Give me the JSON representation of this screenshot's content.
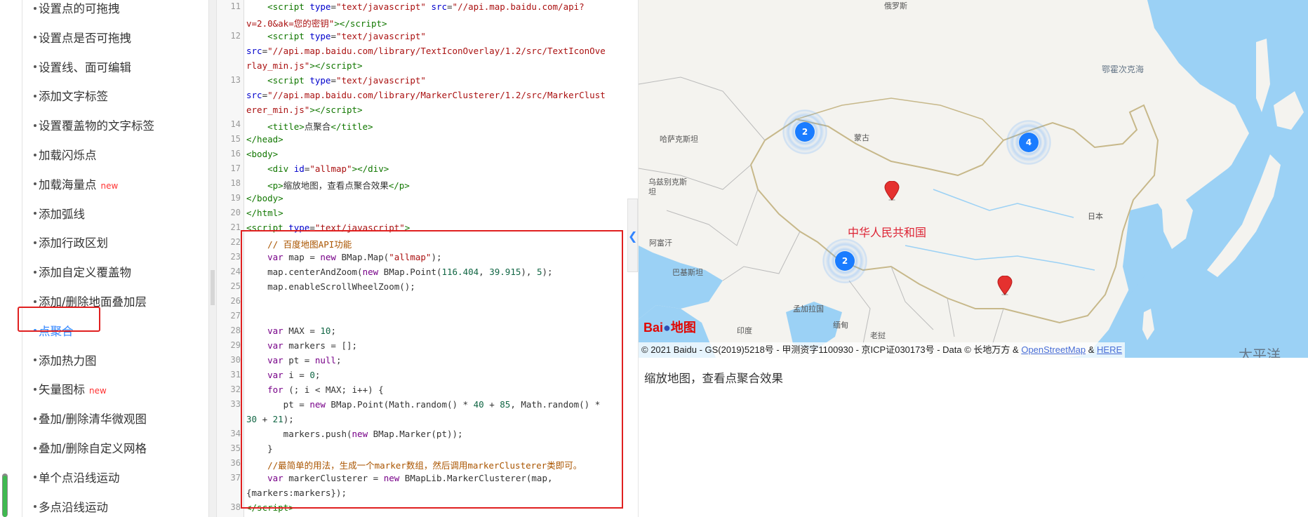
{
  "sidebar": {
    "items": [
      {
        "label": "设置点的可拖拽",
        "badge": ""
      },
      {
        "label": "设置点是否可拖拽",
        "badge": ""
      },
      {
        "label": "设置线、面可编辑",
        "badge": ""
      },
      {
        "label": "添加文字标签",
        "badge": ""
      },
      {
        "label": "设置覆盖物的文字标签",
        "badge": ""
      },
      {
        "label": "加载闪烁点",
        "badge": ""
      },
      {
        "label": "加载海量点",
        "badge": "new"
      },
      {
        "label": "添加弧线",
        "badge": ""
      },
      {
        "label": "添加行政区划",
        "badge": ""
      },
      {
        "label": "添加自定义覆盖物",
        "badge": ""
      },
      {
        "label": "添加/删除地面叠加层",
        "badge": ""
      },
      {
        "label": "点聚合",
        "badge": "",
        "active": true
      },
      {
        "label": "添加热力图",
        "badge": ""
      },
      {
        "label": "矢量图标",
        "badge": "new"
      },
      {
        "label": "叠加/删除清华微观图",
        "badge": ""
      },
      {
        "label": "叠加/删除自定义网格",
        "badge": ""
      },
      {
        "label": "单个点沿线运动",
        "badge": ""
      },
      {
        "label": "多点沿线运动",
        "badge": ""
      }
    ]
  },
  "editor": {
    "line_numbers": [
      "11",
      "12",
      "13",
      "14",
      "15",
      "16",
      "17",
      "18",
      "19",
      "20",
      "21",
      "22",
      "23",
      "24",
      "25",
      "26",
      "27",
      "28",
      "29",
      "30",
      "31",
      "32",
      "33",
      "34",
      "35",
      "36",
      "37",
      "38"
    ]
  },
  "map": {
    "labels": {
      "russia": "俄罗斯",
      "okhotsk": "鄂霍次克海",
      "kazakhstan": "哈萨克斯坦",
      "mongolia": "蒙古",
      "uzbekistan": "乌兹别克斯坦",
      "afghanistan": "阿富汗",
      "pakistan": "巴基斯坦",
      "china": "中华人民共和国",
      "japan": "日本",
      "india": "印度",
      "bangladesh": "孟加拉国",
      "myanmar": "缅甸",
      "laos": "老挝",
      "pacific": "太平洋"
    },
    "clusters": [
      {
        "count": "2"
      },
      {
        "count": "4"
      },
      {
        "count": "2"
      }
    ],
    "logo_text_1": "Bai",
    "logo_text_2": "地图",
    "copyright_prefix": "© 2021 Baidu - GS(2019)5218号 - 甲测资字1100930 - 京ICP证030173号 - Data © 长地万方 & ",
    "osm_link": "OpenStreetMap",
    "amp": " & ",
    "here_link": "HERE",
    "water_color": "#9bd1f5",
    "land_color": "#f4f3ef"
  },
  "caption": "缩放地图，查看点聚合效果",
  "colors": {
    "accent": "#3385ff",
    "highlight_border": "#e02020",
    "new_badge": "#ff3333"
  }
}
